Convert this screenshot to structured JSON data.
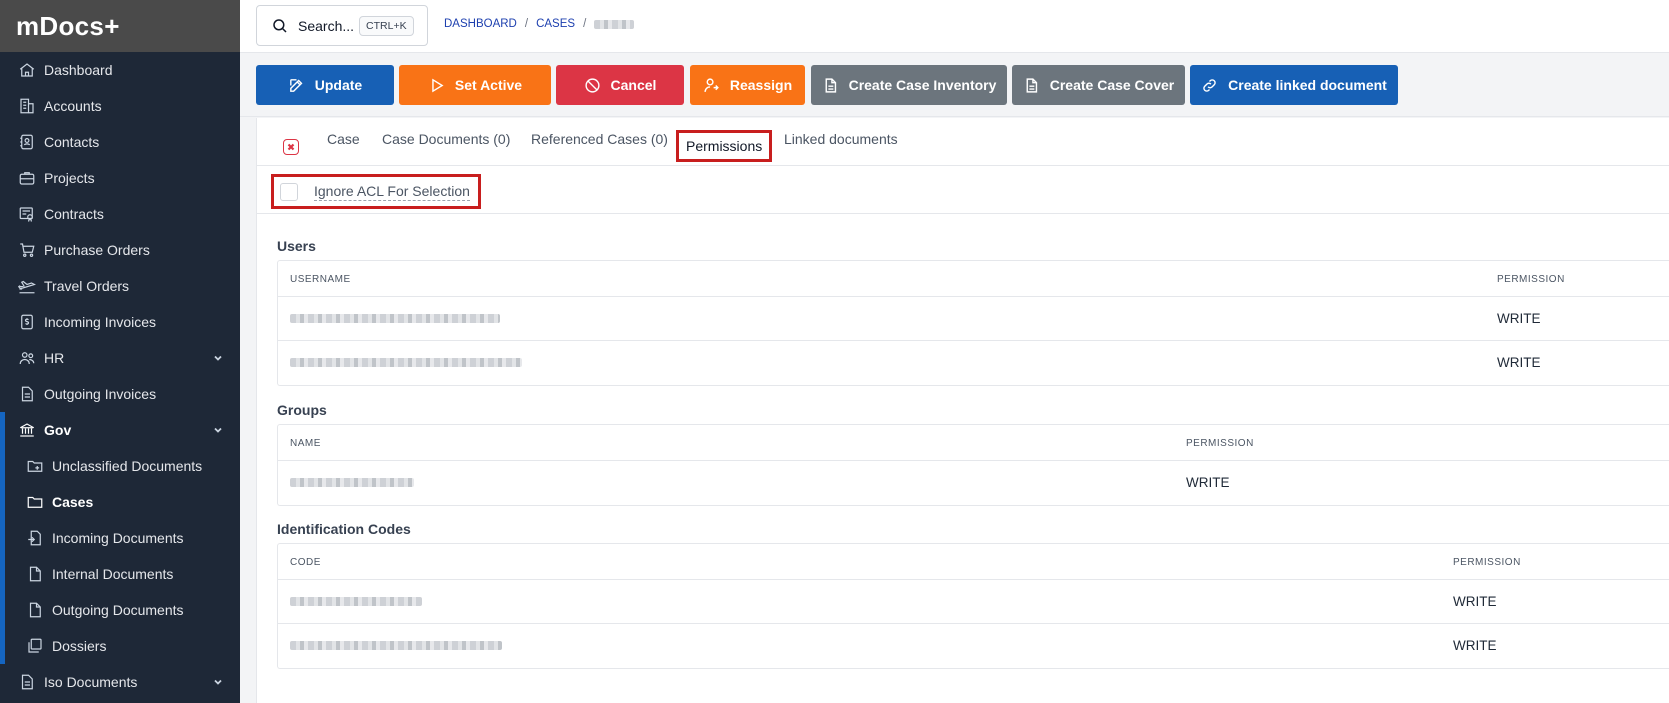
{
  "app": {
    "logo": "mDocs+"
  },
  "sidebar": {
    "items": [
      {
        "label": "Dashboard",
        "icon": "home-icon"
      },
      {
        "label": "Accounts",
        "icon": "building-icon"
      },
      {
        "label": "Contacts",
        "icon": "contacts-icon"
      },
      {
        "label": "Projects",
        "icon": "briefcase-icon"
      },
      {
        "label": "Contracts",
        "icon": "contract-icon"
      },
      {
        "label": "Purchase Orders",
        "icon": "cart-icon"
      },
      {
        "label": "Travel Orders",
        "icon": "plane-icon"
      },
      {
        "label": "Incoming Invoices",
        "icon": "invoice-icon"
      },
      {
        "label": "HR",
        "icon": "people-icon"
      },
      {
        "label": "Outgoing Invoices",
        "icon": "document-icon"
      },
      {
        "label": "Gov",
        "icon": "bank-icon"
      },
      {
        "label": "Iso Documents",
        "icon": "document-icon"
      }
    ],
    "gov_children": [
      {
        "label": "Unclassified Documents",
        "icon": "folder-plus-icon"
      },
      {
        "label": "Cases",
        "icon": "folder-icon"
      },
      {
        "label": "Incoming Documents",
        "icon": "file-in-icon"
      },
      {
        "label": "Internal Documents",
        "icon": "file-icon"
      },
      {
        "label": "Outgoing Documents",
        "icon": "file-out-icon"
      },
      {
        "label": "Dossiers",
        "icon": "stack-icon"
      }
    ]
  },
  "topbar": {
    "search_label": "Search...",
    "search_shortcut": "CTRL+K",
    "breadcrumb": [
      "DASHBOARD",
      "CASES"
    ]
  },
  "toolbar": {
    "update": "Update",
    "set_active": "Set Active",
    "cancel": "Cancel",
    "reassign": "Reassign",
    "create_case_inventory": "Create Case Inventory",
    "create_case_cover": "Create Case Cover",
    "create_linked_document": "Create linked document"
  },
  "tabs": {
    "case": "Case",
    "case_documents": "Case Documents (0)",
    "referenced_cases": "Referenced Cases (0)",
    "permissions": "Permissions",
    "linked_documents": "Linked documents"
  },
  "acl": {
    "label": "Ignore ACL For Selection"
  },
  "users": {
    "title": "Users",
    "col_username": "USERNAME",
    "col_permission": "PERMISSION",
    "rows": [
      {
        "permission": "WRITE"
      },
      {
        "permission": "WRITE"
      }
    ]
  },
  "groups": {
    "title": "Groups",
    "col_name": "NAME",
    "col_permission": "PERMISSION",
    "rows": [
      {
        "permission": "WRITE"
      }
    ]
  },
  "codes": {
    "title": "Identification Codes",
    "col_code": "CODE",
    "col_permission": "PERMISSION",
    "rows": [
      {
        "permission": "WRITE"
      },
      {
        "permission": "WRITE"
      }
    ]
  }
}
